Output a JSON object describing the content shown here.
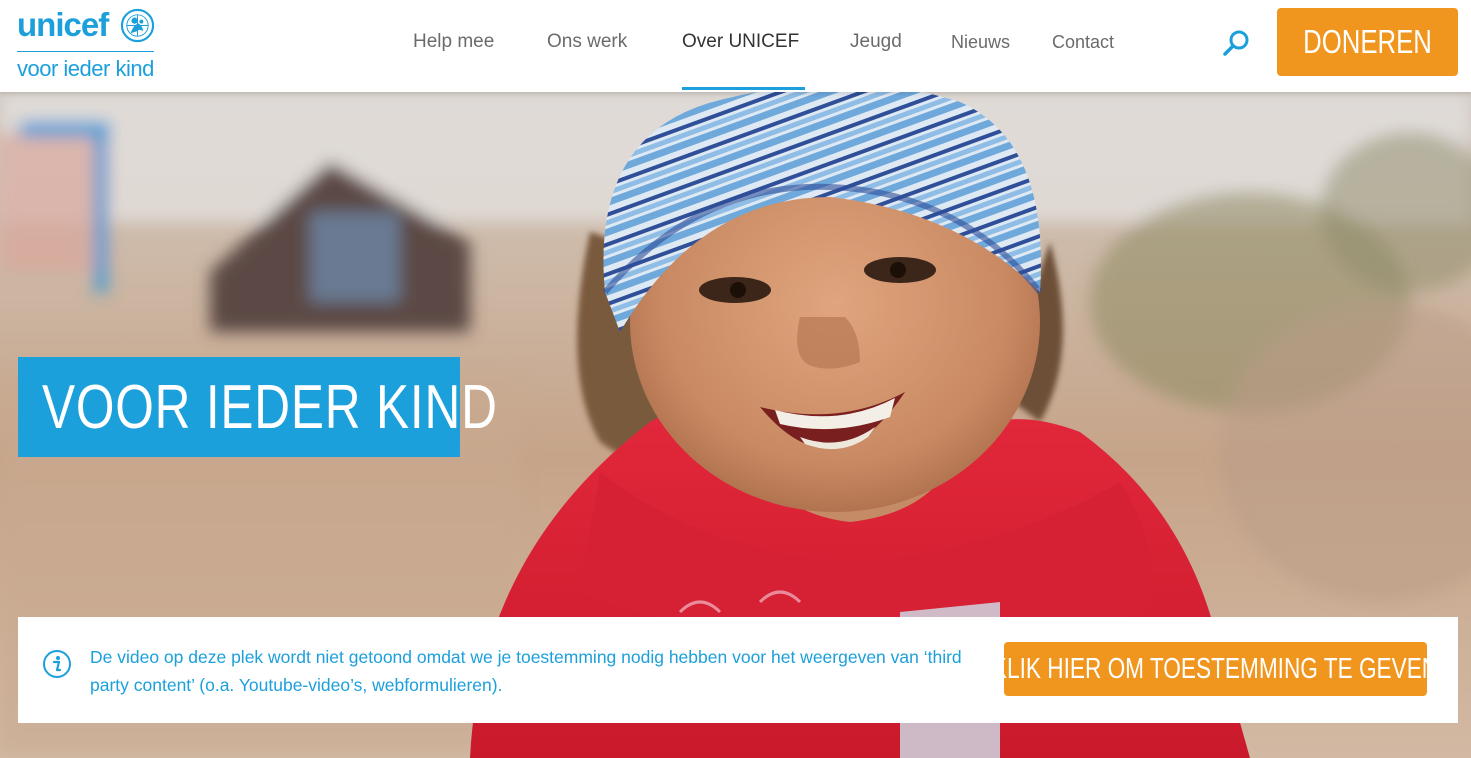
{
  "brand": {
    "logo_word": "unicef",
    "tagline": "voor ieder kind",
    "color": "#1ca0dc"
  },
  "nav": {
    "items": [
      {
        "label": "Help mee"
      },
      {
        "label": "Ons werk"
      },
      {
        "label": "Over UNICEF",
        "active": true
      },
      {
        "label": "Jeugd"
      },
      {
        "label": "Nieuws"
      },
      {
        "label": "Contact"
      }
    ],
    "search_icon": "search-icon"
  },
  "donate": {
    "label": "DONEREN",
    "color": "#f0961e"
  },
  "hero": {
    "title": "VOOR IEDER KIND",
    "image": "smiling child in blue striped beanie and red hooded jacket"
  },
  "consent": {
    "icon": "info-icon",
    "message": "De video op deze plek wordt niet getoond omdat we je toestemming nodig hebben voor het weergeven van ‘third party content’ (o.a. Youtube-video’s, webformulieren).",
    "button_label": "KLIK HIER OM TOESTEMMING TE GEVEN"
  }
}
